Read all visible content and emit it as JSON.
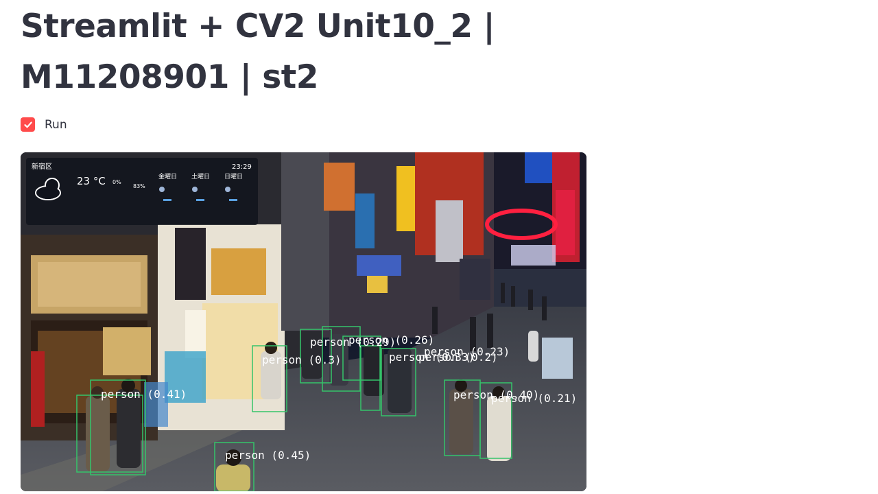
{
  "page": {
    "title_line1": "Streamlit + CV2 Unit10_2 |",
    "title_line2": "M11208901 | st2"
  },
  "run_checkbox": {
    "label": "Run",
    "checked": true
  },
  "video_frame": {
    "weather": {
      "location": "新宿区",
      "time": "23:29",
      "temperature": "23 °C",
      "humidity": "83%",
      "precip": "0%",
      "forecast_days": [
        "金曜日",
        "土曜日",
        "日曜日"
      ]
    },
    "detection_color": "#35c46a",
    "detections": [
      {
        "label": "person (0.3)"
      },
      {
        "label": "person (0.29)"
      },
      {
        "label": "person (0.26)"
      },
      {
        "label": "person (0.23)"
      },
      {
        "label": "person (0.33)"
      },
      {
        "label": "person (0.2)"
      },
      {
        "label": "person (0.41)"
      },
      {
        "label": "person (0.40)"
      },
      {
        "label": "person (0.21)"
      },
      {
        "label": "person (0.45)"
      }
    ]
  }
}
